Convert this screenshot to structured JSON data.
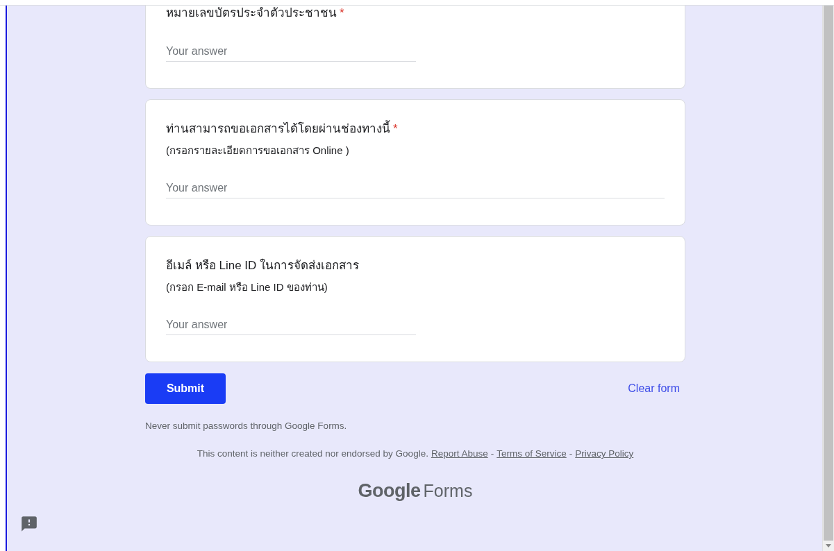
{
  "form": {
    "required_mark": "*",
    "questions": [
      {
        "kind": "short",
        "title": "หมายเลขบัตรประจำตัวประชาชน",
        "required": true,
        "placeholder": "Your answer"
      },
      {
        "kind": "long",
        "title": "ท่านสามารถขอเอกสารได้โดยผ่านช่องทางนี้",
        "required": true,
        "description": "(กรอกรายละเอียดการขอเอกสาร Online )",
        "placeholder": "Your answer"
      },
      {
        "kind": "short",
        "title": "อีเมล์ หรือ Line ID ในการจัดส่งเอกสาร",
        "required": false,
        "description": "(กรอก E-mail หรือ Line ID ของท่าน)",
        "placeholder": "Your answer"
      }
    ],
    "submit": "Submit",
    "clear": "Clear form"
  },
  "footer": {
    "warning": "Never submit passwords through Google Forms.",
    "disclaimer": "This content is neither created nor endorsed by Google.",
    "links": [
      "Report Abuse",
      "Terms of Service",
      "Privacy Policy"
    ],
    "separator": "-",
    "logo": {
      "brand": "Google",
      "product": "Forms"
    }
  }
}
